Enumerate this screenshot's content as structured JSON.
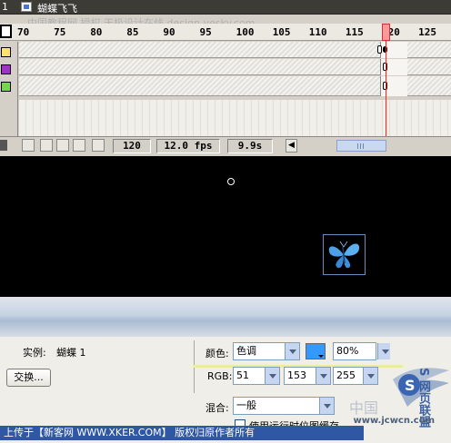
{
  "window": {
    "frame_number": "1",
    "symbol_name": "蝴蝶飞飞"
  },
  "watermark": "中国教程网 授权 天极设计在线 design.yesky.com",
  "timeline": {
    "ruler_labels": [
      "70",
      "75",
      "80",
      "85",
      "90",
      "95",
      "100",
      "105",
      "110",
      "115",
      "120",
      "125"
    ],
    "current_frame_label": "120",
    "layers": [
      {
        "color": "#ffe36b"
      },
      {
        "color": "#a033c7"
      },
      {
        "color": "#74d94a"
      }
    ],
    "status": {
      "frame": "120",
      "fps": "12.0 fps",
      "time": "9.9s"
    }
  },
  "properties": {
    "instance_label": "实例:",
    "instance_name": "蝴蝶 1",
    "swap_button": "交换...",
    "color_label": "颜色:",
    "color_mode": "色调",
    "tint_percent": "80%",
    "tint_color": "#3399ff",
    "rgb_label": "RGB:",
    "r": "51",
    "g": "153",
    "b": "255",
    "blend_label": "混合:",
    "blend_mode": "一般",
    "cache_label": "使用运行时位图缓存"
  },
  "footer": "上传于【新客网 WWW.XKER.COM】 版权归原作者所有",
  "site_mark": "www.jcwcn.com",
  "logo_text": "S 网页联盟",
  "zh_mark": "中国"
}
